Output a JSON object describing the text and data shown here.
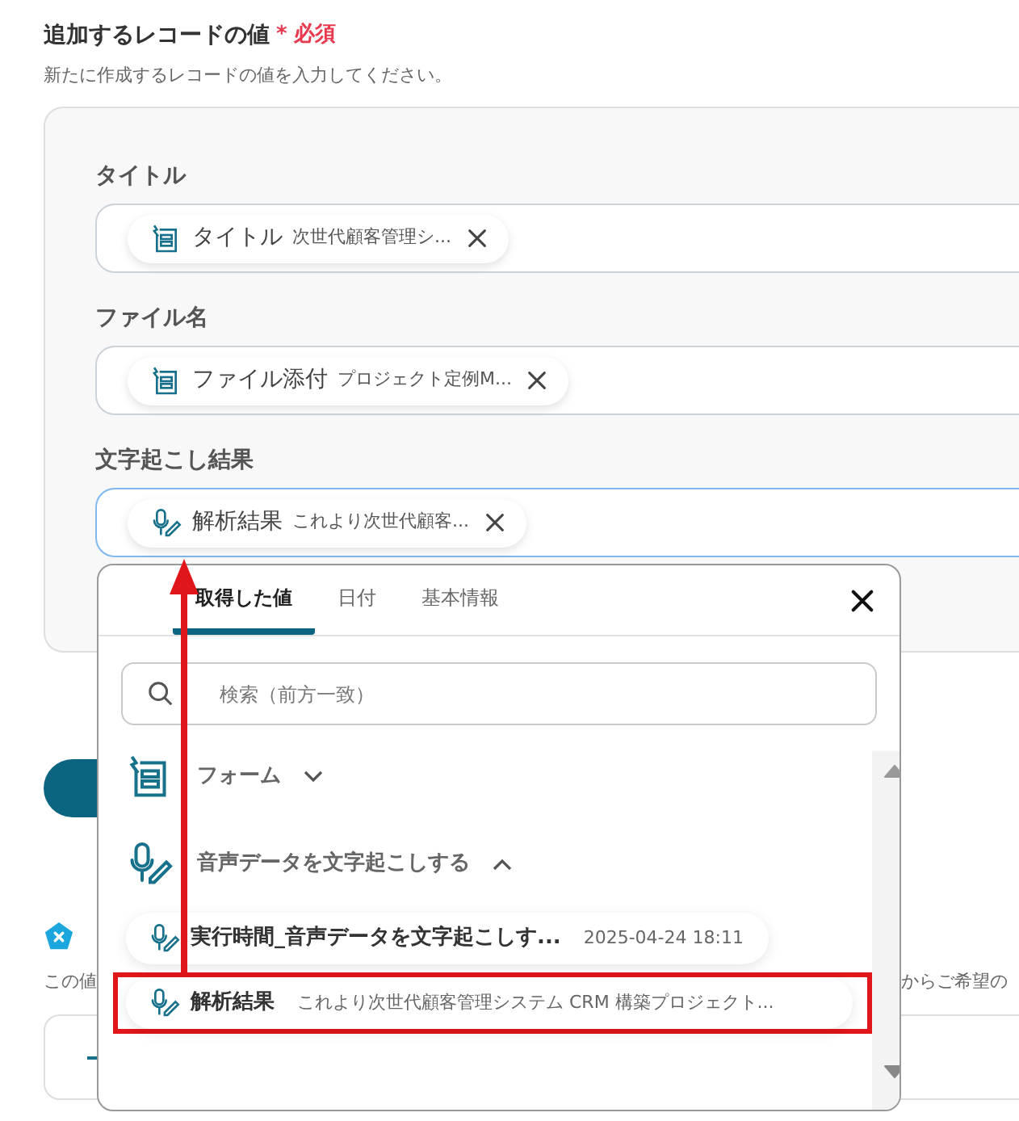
{
  "header": {
    "title": "追加するレコードの値",
    "required_mark": "*",
    "required_label": "必須",
    "description": "新たに作成するレコードの値を入力してください。"
  },
  "fields": [
    {
      "label": "タイトル",
      "focused": false,
      "chip": {
        "kind": "form",
        "name": "タイトル",
        "value": "次世代顧客管理シ..."
      }
    },
    {
      "label": "ファイル名",
      "focused": false,
      "chip": {
        "kind": "form",
        "name": "ファイル添付",
        "value": "プロジェクト定例M..."
      }
    },
    {
      "label": "文字起こし結果",
      "focused": true,
      "chip": {
        "kind": "voice",
        "name": "解析結果",
        "value": "これより次世代顧客..."
      }
    }
  ],
  "background_section": {
    "description_left": "この値",
    "description_right": "からご希望の"
  },
  "popover": {
    "tabs": [
      {
        "label": "取得した値",
        "selected": true
      },
      {
        "label": "日付",
        "selected": false
      },
      {
        "label": "基本情報",
        "selected": false
      }
    ],
    "search": {
      "placeholder": "検索（前方一致）"
    },
    "groups": [
      {
        "kind": "form",
        "label": "フォーム",
        "expanded": false
      },
      {
        "kind": "voice",
        "label": "音声データを文字起こしする",
        "expanded": true,
        "children": [
          {
            "name": "実行時間_音声データを文字起こしす...",
            "value": "2025-04-24 18:11",
            "highlighted": false
          },
          {
            "name": "解析結果",
            "value": "これより次世代顧客管理システム CRM 構築プロジェクト...",
            "highlighted": true
          }
        ]
      }
    ]
  }
}
